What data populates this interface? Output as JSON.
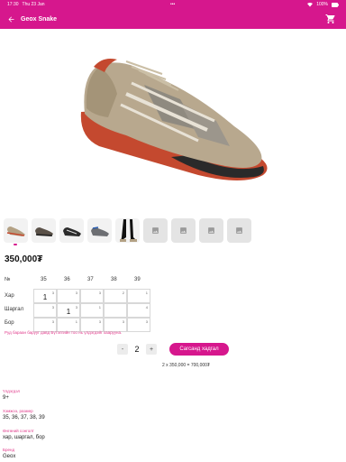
{
  "status": {
    "time": "17:30",
    "date": "Thu 23 Jan",
    "dots": "•••",
    "battery": "100%"
  },
  "app_bar": {
    "title": "Geox Snake"
  },
  "icons": {
    "back": "back-arrow-icon",
    "cart": "cart-icon",
    "placeholder": "image-placeholder-icon"
  },
  "colors": {
    "accent": "#d6178d"
  },
  "thumbnails": [
    "thumb-1",
    "thumb-2",
    "thumb-3",
    "thumb-4",
    "thumb-5",
    "placeholder",
    "placeholder",
    "placeholder",
    "placeholder"
  ],
  "price": "350,000₮",
  "sizes": {
    "corner": "№",
    "headers": [
      "35",
      "36",
      "37",
      "38",
      "39"
    ],
    "rows": [
      {
        "label": "Хар",
        "cells": [
          {
            "sup": "3",
            "val": "1"
          },
          {
            "sup": "3",
            "val": ""
          },
          {
            "sup": "3",
            "val": ""
          },
          {
            "sup": "2",
            "val": ""
          },
          {
            "sup": "1",
            "val": ""
          }
        ]
      },
      {
        "label": "Шаргал",
        "cells": [
          {
            "sup": "3",
            "val": ""
          },
          {
            "sup": "3",
            "val": "1"
          },
          {
            "sup": "1",
            "val": ""
          },
          {
            "sup": "",
            "val": ""
          },
          {
            "sup": "4",
            "val": ""
          }
        ]
      },
      {
        "label": "Бор",
        "cells": [
          {
            "sup": "3",
            "val": ""
          },
          {
            "sup": "1",
            "val": ""
          },
          {
            "sup": "3",
            "val": ""
          },
          {
            "sup": "3",
            "val": ""
          },
          {
            "sup": "3",
            "val": ""
          }
        ]
      }
    ]
  },
  "warning": "Руд бараан барууг давд Бүтэлгийн тоо нь үлдэгдэйг хаарууна.",
  "quantity": {
    "minus": "-",
    "value": "2",
    "plus": "+"
  },
  "add_to_cart": "Сагсанд хадгал",
  "total": "2 x 350,000 = 700,000₮",
  "details": [
    {
      "label": "Үлдэгдэл",
      "value": "9+"
    },
    {
      "label": "Хэмжээ, размер",
      "value": "35, 36, 37, 38, 39"
    },
    {
      "label": "Өнгөний сонголт",
      "value": "хар, шаргал, бор"
    },
    {
      "label": "Бренд",
      "value": "Geox"
    }
  ]
}
